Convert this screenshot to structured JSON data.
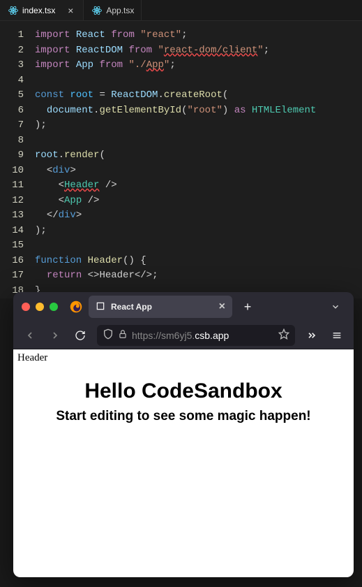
{
  "editor": {
    "tabs": [
      {
        "name": "index.tsx",
        "active": true,
        "closeVisible": true
      },
      {
        "name": "App.tsx",
        "active": false,
        "closeVisible": false
      }
    ],
    "code": {
      "lines": 18,
      "t": {
        "import": "import",
        "React": "React",
        "from": "from",
        "react": "\"react\"",
        "semi": ";",
        "ReactDOM": "ReactDOM",
        "reactDomClient": "react-dom/client",
        "App": "App",
        "appPath": "\"./App\"",
        "const": "const",
        "root": "root",
        "eq": "=",
        "createRoot": "createRoot",
        "lparen": "(",
        "document": "document",
        "dot": ".",
        "getElementById": "getElementById",
        "rootStr": "\"root\"",
        "rparen": ")",
        "as": "as",
        "HTMLElement": "HTMLElement",
        "closeParenSemi": ");",
        "render": "render",
        "ltDiv": "<",
        "div": "div",
        "gt": ">",
        "ltSlash": "</",
        "slashGt": "/>",
        "Header": "Header",
        "function": "function",
        "emptyParens": "()",
        "brace": "{",
        "return": "return",
        "fragOpen": "<>",
        "HeaderText": "Header",
        "fragClose": "</>",
        "cbrace": "}",
        "q": "\"",
        "ltApp": "App"
      }
    }
  },
  "browser": {
    "tab": {
      "title": "React App"
    },
    "url": {
      "dim": "https://sm6yj5.",
      "bright": "csb.app"
    },
    "page": {
      "headerText": "Header",
      "h1": "Hello CodeSandbox",
      "h2": "Start editing to see some magic happen!"
    }
  }
}
